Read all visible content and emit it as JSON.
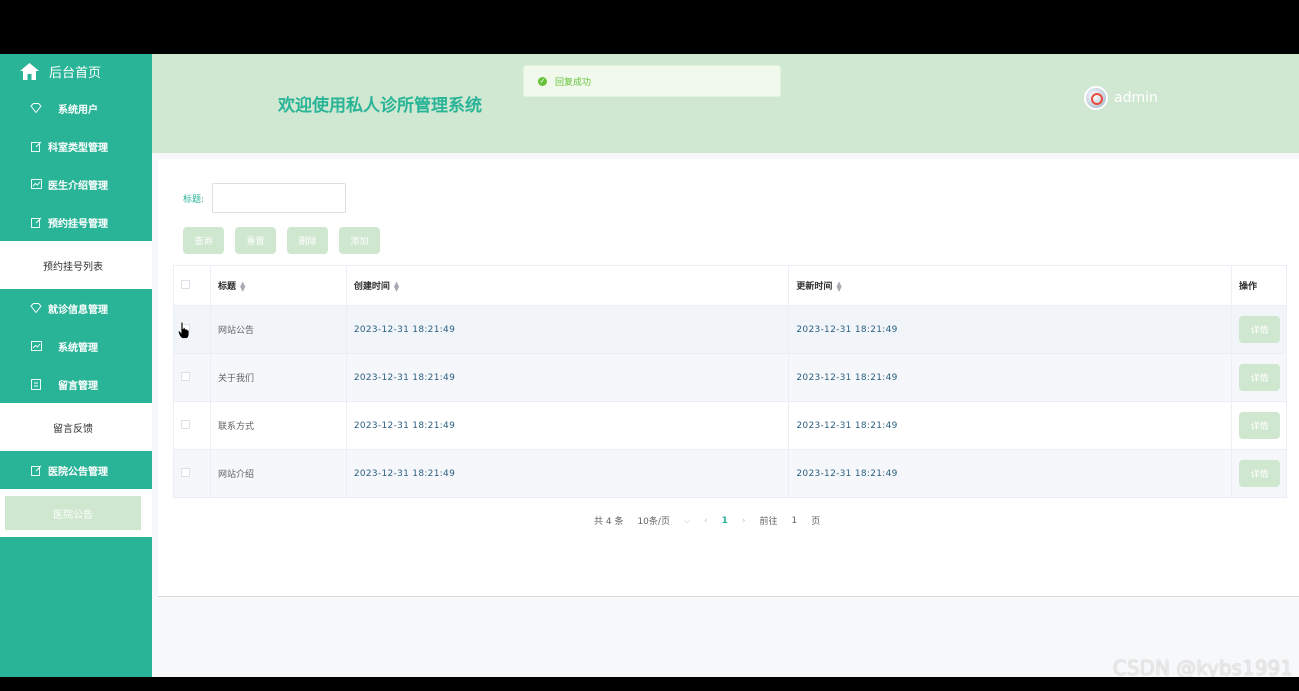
{
  "sidebar": {
    "home": "后台首页",
    "items": [
      {
        "label": "系统用户"
      },
      {
        "label": "科室类型管理"
      },
      {
        "label": "医生介绍管理"
      },
      {
        "label": "预约挂号管理"
      },
      {
        "label": "预约挂号列表"
      },
      {
        "label": "就诊信息管理"
      },
      {
        "label": "系统管理"
      },
      {
        "label": "留言管理"
      },
      {
        "label": "留言反馈"
      },
      {
        "label": "医院公告管理"
      },
      {
        "label": "医院公告"
      }
    ]
  },
  "header": {
    "title": "欢迎使用私人诊所管理系统",
    "toast": "回复成功",
    "user": "admin"
  },
  "search": {
    "label": "标题:",
    "value": ""
  },
  "buttons": {
    "query": "查询",
    "reset": "重置",
    "delete": "删除",
    "add": "添加"
  },
  "table": {
    "headers": {
      "title": "标题",
      "created": "创建时间",
      "updated": "更新时间",
      "action": "操作"
    },
    "rows": [
      {
        "title": "网站公告",
        "created": "2023-12-31 18:21:49",
        "updated": "2023-12-31 18:21:49",
        "action": "详情"
      },
      {
        "title": "关于我们",
        "created": "2023-12-31 18:21:49",
        "updated": "2023-12-31 18:21:49",
        "action": "详情"
      },
      {
        "title": "联系方式",
        "created": "2023-12-31 18:21:49",
        "updated": "2023-12-31 18:21:49",
        "action": "详情"
      },
      {
        "title": "网站介绍",
        "created": "2023-12-31 18:21:49",
        "updated": "2023-12-31 18:21:49",
        "action": "详情"
      }
    ]
  },
  "pagination": {
    "total": "共 4 条",
    "page_size": "10条/页",
    "current": "1",
    "goto_prefix": "前往",
    "goto_value": "1",
    "goto_suffix": "页"
  },
  "watermark": "CSDN @kybs1991",
  "colors": {
    "primary": "#2ab497",
    "header_bg": "#d0e8d2",
    "button_bg": "#cfe6cf",
    "success": "#67c23a"
  }
}
